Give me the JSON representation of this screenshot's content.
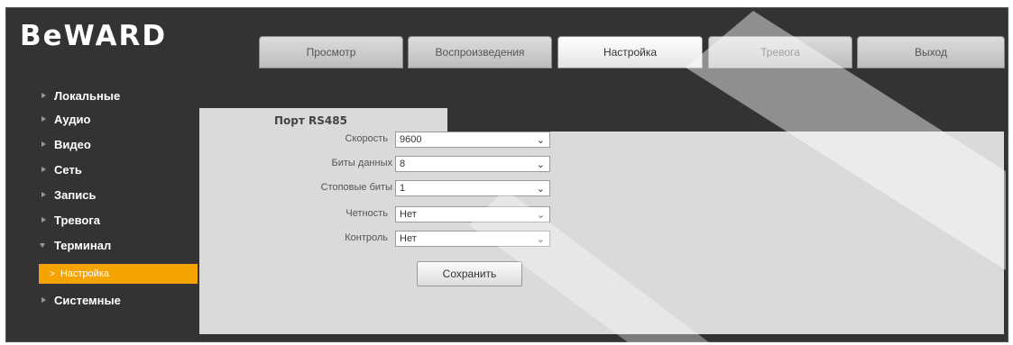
{
  "brand": {
    "logo": "BeWARD"
  },
  "nav": {
    "tabs": [
      {
        "label": "Просмотр"
      },
      {
        "label": "Воспроизведения"
      },
      {
        "label": "Настройка",
        "active": true
      },
      {
        "label": "Тревога"
      },
      {
        "label": "Выход"
      }
    ]
  },
  "sidebar": {
    "items": [
      {
        "label": "Локальные"
      },
      {
        "label": "Аудио"
      },
      {
        "label": "Видео"
      },
      {
        "label": "Сеть"
      },
      {
        "label": "Запись"
      },
      {
        "label": "Тревога"
      },
      {
        "label": "Терминал",
        "expanded": true
      },
      {
        "label": "Системные"
      }
    ],
    "active_sub": {
      "label": "Настройка"
    }
  },
  "page": {
    "subtab": "Порт RS485",
    "fields": [
      {
        "label": "Скорость",
        "value": "9600"
      },
      {
        "label": "Биты данных",
        "value": "8"
      },
      {
        "label": "Стоповые биты",
        "value": "1"
      },
      {
        "label": "Четность",
        "value": "Нет"
      },
      {
        "label": "Контроль",
        "value": "Нет"
      }
    ],
    "save_label": "Сохранить"
  },
  "colors": {
    "frame": "#333333",
    "panel": "#dadada",
    "accent": "#f4a300"
  }
}
